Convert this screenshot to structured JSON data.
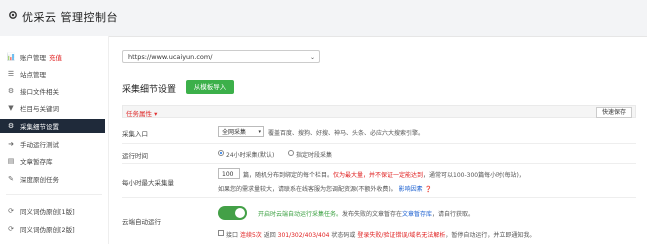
{
  "header": {
    "title": "优采云 管理控制台",
    "icon": "gear-icon"
  },
  "sidebar": {
    "items": [
      {
        "icon": "bar-chart-icon",
        "glyph": "📊",
        "label": "账户管理",
        "badge": "充值"
      },
      {
        "icon": "list-icon",
        "glyph": "☰",
        "label": "站点管理"
      },
      {
        "icon": "plug-icon",
        "glyph": "⚙",
        "label": "接口文件相关"
      },
      {
        "icon": "filter-icon",
        "glyph": "▼",
        "label": "栏目与关键词"
      },
      {
        "icon": "gears-icon",
        "glyph": "⚙",
        "label": "采集细节设置",
        "active": true
      },
      {
        "icon": "arrow-right-icon",
        "glyph": "➜",
        "label": "手动运行测试"
      },
      {
        "icon": "document-icon",
        "glyph": "▤",
        "label": "文章暂存库"
      },
      {
        "icon": "edit-icon",
        "glyph": "✎",
        "label": "深度原创任务"
      },
      {
        "icon": "refresh-icon",
        "glyph": "⟳",
        "label": "同义词伪原创[1版]"
      },
      {
        "icon": "refresh-icon",
        "glyph": "⟳",
        "label": "同义词伪原创[2版]"
      }
    ]
  },
  "main": {
    "site_url": "https://www.ucaiyun.com/",
    "section_title": "采集细节设置",
    "import_button": "从模板导入",
    "task_property_label": "任务属性",
    "quick_save": "快速保存",
    "collect_entry": {
      "label": "采集入口",
      "selected": "全网采集",
      "description": "覆盖百度、搜狗、好搜、神马、头条、必应六大搜索引擎。"
    },
    "run_time": {
      "label": "运行时间",
      "option1": "24小时采集(默认)",
      "option2": "指定时段采集"
    },
    "max_per_run": {
      "label": "每小时最大采集量",
      "value": "100",
      "unit": "篇",
      "desc_a": "，随机分布到绑定的每个栏目。",
      "desc_red": "仅为最大量，并不保证一定能达到",
      "desc_b": "，通常可以100-300篇每小时(每站)，",
      "desc_line2": "如果您的需求量较大，请联系在线客服为您调配资源(不额外收费)。",
      "desc_link": "影响因素"
    },
    "cloud_run": {
      "label": "云端自动运行",
      "on": true,
      "desc_green": "开启时云端自动运行采集任务。",
      "desc_a": "发布失败的文章暂存在",
      "desc_link": "文章暂存库",
      "desc_b": "，请自行获取。"
    },
    "interface_check": {
      "a": "接口",
      "red1": "连续5次",
      "b": "返回",
      "codes": "301/302/403/404",
      "c": "状态码或",
      "red2": "登录失败/验证错误/域名无法解析",
      "d": "，暂停自动运行，并立即通知我。"
    }
  }
}
